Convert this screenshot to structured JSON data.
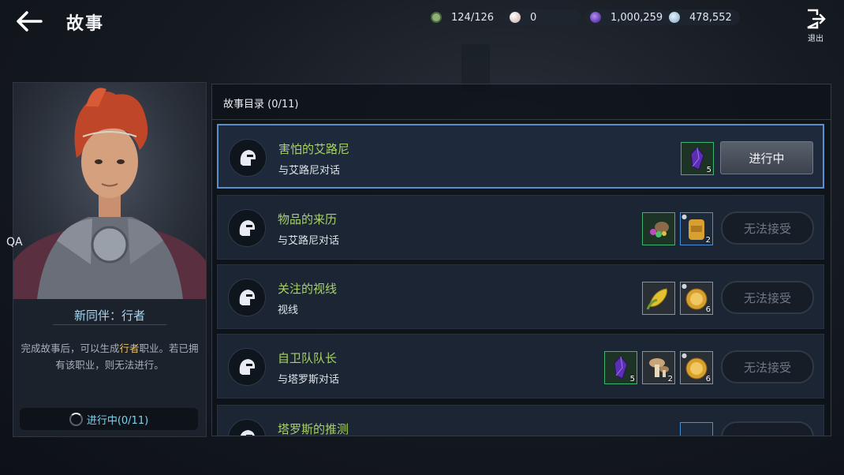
{
  "header": {
    "title": "故事",
    "exit_label": "退出"
  },
  "currencies": [
    {
      "icon": "energy-icon",
      "value": "124/126",
      "color": "#8fb07a"
    },
    {
      "icon": "pearl-icon",
      "value": "0",
      "color": "#d8c6c4"
    },
    {
      "icon": "black-stone-icon",
      "value": "1,000,259",
      "color": "#7a4fd0"
    },
    {
      "icon": "silver-coin-icon",
      "value": "478,552",
      "color": "#a8c8e0"
    }
  ],
  "card": {
    "side_label": "QA",
    "title": "新同伴：行者",
    "desc_before": "完成故事后，可以生成",
    "desc_highlight": "行者",
    "desc_after": "职业。若已拥有该职业，则无法进行。",
    "progress": "进行中(0/11)"
  },
  "list": {
    "header": "故事目录 (0/11)",
    "rows": [
      {
        "title": "害怕的艾路尼",
        "sub": "与艾路尼对话",
        "button": "进行中",
        "rewards": [
          {
            "icon": "purple-crystal-icon",
            "count": "5"
          }
        ]
      },
      {
        "title": "物品的来历",
        "sub": "与艾路尼对话",
        "button": "无法接受",
        "rewards": [
          {
            "icon": "gem-pile-icon",
            "count": ""
          },
          {
            "icon": "backpack-icon",
            "count": "2"
          }
        ]
      },
      {
        "title": "关注的视线",
        "sub": "视线",
        "button": "无法接受",
        "rewards": [
          {
            "icon": "corn-icon",
            "count": ""
          },
          {
            "icon": "gold-plate-icon",
            "count": "6"
          }
        ]
      },
      {
        "title": "自卫队队长",
        "sub": "与塔罗斯对话",
        "button": "无法接受",
        "rewards": [
          {
            "icon": "purple-crystal-icon",
            "count": "5"
          },
          {
            "icon": "mushroom-icon",
            "count": "2"
          },
          {
            "icon": "gold-plate-icon",
            "count": "6"
          }
        ]
      },
      {
        "title": "塔罗斯的推测",
        "sub": "",
        "button": "",
        "rewards": []
      }
    ]
  }
}
